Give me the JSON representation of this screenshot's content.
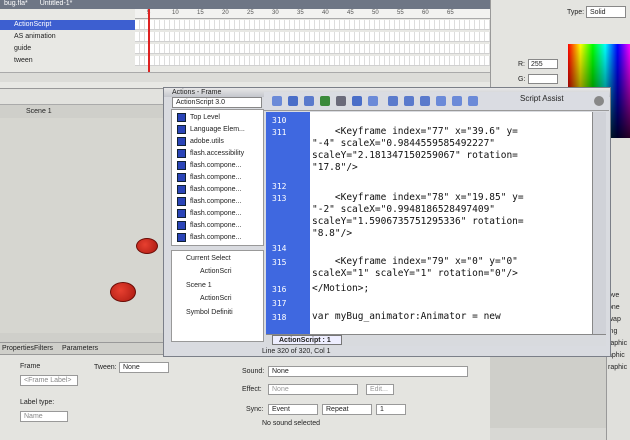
{
  "tabs": {
    "doc1": "bug.fla*",
    "doc2": "Untitled-1*"
  },
  "timeline": {
    "ruler": [
      "5",
      "10",
      "15",
      "20",
      "25",
      "30",
      "35",
      "40",
      "45",
      "50",
      "55",
      "60",
      "65"
    ],
    "layers": [
      {
        "name": "ActionScript",
        "selected": true
      },
      {
        "name": "AS animation",
        "selected": false
      },
      {
        "name": "guide",
        "selected": false
      },
      {
        "name": "tween",
        "selected": false
      }
    ]
  },
  "stage": {
    "scene": "Scene 1"
  },
  "color_panel": {
    "type_label": "Type:",
    "type_value": "Solid",
    "r_label": "R:",
    "r_value": "255",
    "g_label": "G:",
    "b_label": "B:"
  },
  "actions": {
    "title": "Actions - Frame",
    "language": "ActionScript 3.0",
    "toolbox": [
      "Top Level",
      "Language Elem...",
      "adobe.utils",
      "flash.accessibility",
      "flash.compone...",
      "flash.compone...",
      "flash.compone...",
      "flash.compone...",
      "flash.compone...",
      "flash.compone...",
      "flash.compone..."
    ],
    "tree": {
      "current_selection": "Current Select",
      "current_item": "ActionScri",
      "scene": "Scene 1",
      "scene_item": "ActionScri",
      "symbol_def": "Symbol Definiti"
    },
    "script_assist": "Script Assist",
    "line_numbers": [
      "310",
      "311",
      "312",
      "313",
      "314",
      "315",
      "316",
      "317",
      "318"
    ],
    "code": [
      "",
      "    <Keyframe index=\"77\" x=\"39.6\" y=",
      "\"-4\" scaleX=\"0.9844559585492227\"",
      "scaleY=\"2.181347150259067\" rotation=",
      "\"17.8\"/>",
      "",
      "    <Keyframe index=\"78\" x=\"19.85\" y=",
      "\"-2\" scaleX=\"0.9948186528497409\"",
      "scaleY=\"1.5906735751295336\" rotation=",
      "\"8.8\"/>",
      "",
      "    <Keyframe index=\"79\" x=\"0\" y=\"0\"",
      "scaleX=\"1\" scaleY=\"1\" rotation=\"0\"/>",
      "</Motion>;",
      "",
      "var myBug_animator:Animator = new"
    ],
    "script_tab": "ActionScript : 1",
    "status": "Line 320 of 320, Col 1"
  },
  "properties": {
    "tabs": [
      "Properties",
      "Filters",
      "Parameters"
    ],
    "frame_label": "Frame",
    "frame_placeholder": "<Frame Label>",
    "tween_label": "Tween:",
    "tween_value": "None",
    "label_type": "Label type:",
    "label_type_value": "Name",
    "sound_label": "Sound:",
    "sound_value": "None",
    "effect_label": "Effect:",
    "effect_value": "None",
    "edit_button": "Edit...",
    "sync_label": "Sync:",
    "sync_value": "Event",
    "repeat_value": "Repeat",
    "repeat_count": "1",
    "no_sound": "No sound selected"
  },
  "right_lower": [
    "ove",
    "one",
    "wap",
    "ing",
    "raphic",
    "aphic",
    "raphic"
  ]
}
